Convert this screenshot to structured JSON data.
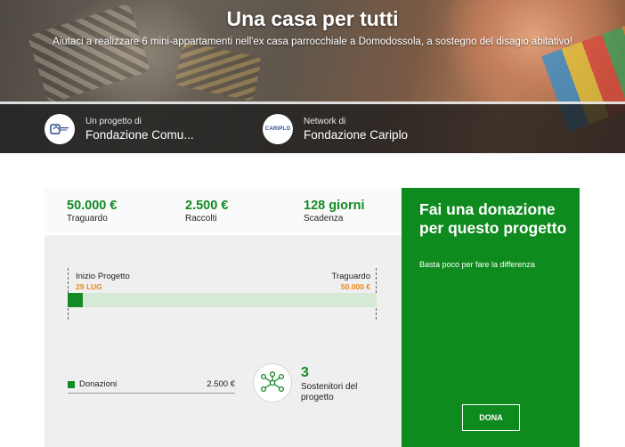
{
  "hero": {
    "title": "Una casa per tutti",
    "subtitle": "Aiutaci a realizzare 6 mini-appartamenti nell'ex casa parrocchiale a Domodossola, a sostegno del disagio abitativo!"
  },
  "organizations": [
    {
      "small": "Un progetto di",
      "name": "Fondazione Comu...",
      "icon": "fondazione-comunitaria-logo-icon"
    },
    {
      "small": "Network di",
      "name": "Fondazione Cariplo",
      "icon": "fondazione-cariplo-logo-icon",
      "logo_text": "CARIPLO"
    }
  ],
  "stats": [
    {
      "value": "50.000 €",
      "label": "Traguardo"
    },
    {
      "value": "2.500 €",
      "label": "Raccolti"
    },
    {
      "value": "128 giorni",
      "label": "Scadenza"
    }
  ],
  "timeline": {
    "start_label": "Inizio Progetto",
    "start_date": "29 LUG",
    "end_label": "Traguardo",
    "end_value": "50.000 €",
    "progress_fraction": 0.05
  },
  "donations": {
    "label": "Donazioni",
    "value": "2.500 €"
  },
  "supporters": {
    "count": "3",
    "label": "Sostenitori del progetto",
    "icon": "network-icon"
  },
  "donate_panel": {
    "title": "Fai una donazione per questo progetto",
    "subtitle": "Basta poco per fare la differenza",
    "button": "DONA"
  },
  "colors": {
    "primary_green": "#138a24",
    "panel_green": "#0f8a1f",
    "accent_orange": "#e8871e",
    "track_green": "#d6e8d6"
  }
}
